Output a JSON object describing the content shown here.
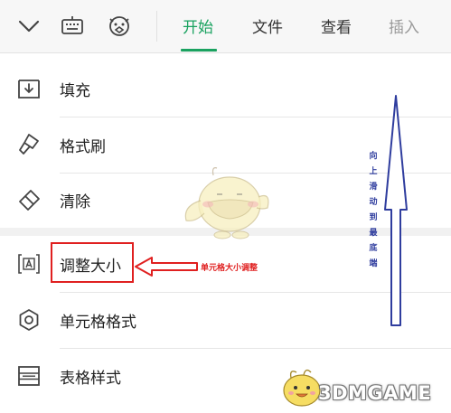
{
  "toolbar": {
    "tabs": [
      {
        "label": "开始",
        "active": true
      },
      {
        "label": "文件"
      },
      {
        "label": "查看"
      },
      {
        "label": "插入"
      }
    ],
    "icons": [
      "chevron-down-icon",
      "keyboard-icon",
      "mascot-face-icon"
    ]
  },
  "menu": {
    "items": [
      {
        "label": "填充",
        "icon": "fill-icon"
      },
      {
        "label": "格式刷",
        "icon": "format-brush-icon"
      },
      {
        "label": "清除",
        "icon": "eraser-icon"
      },
      {
        "label": "调整大小",
        "icon": "resize-icon"
      },
      {
        "label": "单元格格式",
        "icon": "gear-icon"
      },
      {
        "label": "表格样式",
        "icon": "table-style-icon"
      }
    ]
  },
  "annotations": {
    "resize_note": "单元格大小调整",
    "scroll_note": [
      "向",
      "上",
      "滑",
      "动",
      "到",
      "最",
      "底",
      "端"
    ]
  },
  "watermark": {
    "text": "3DMGAME"
  },
  "colors": {
    "accent": "#1aa260",
    "annotation_red": "#e02020",
    "annotation_blue": "#2f3d9e"
  }
}
